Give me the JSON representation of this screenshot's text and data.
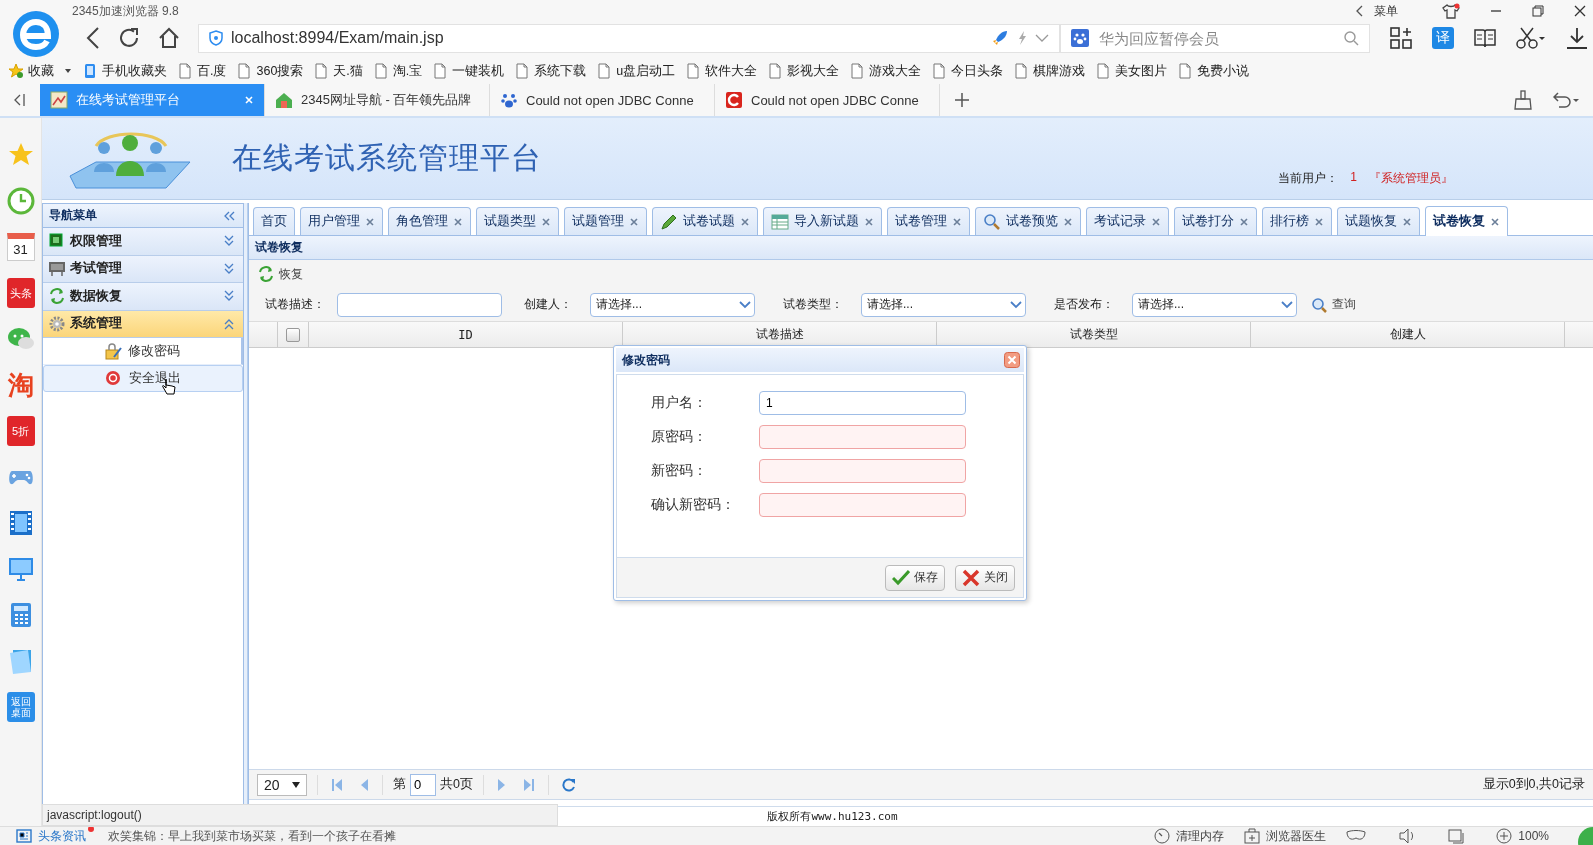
{
  "browser": {
    "title": "2345加速浏览器 9.8",
    "menu_label": "菜单",
    "url": "localhost:8994/Exam/main.jsp",
    "search_placeholder": "华为回应暂停会员",
    "translate_label": "译"
  },
  "bookmarks": [
    {
      "label": "收藏",
      "kind": "star"
    },
    {
      "label": "手机收藏夹",
      "kind": "phone"
    },
    {
      "label": "百.度",
      "kind": "page"
    },
    {
      "label": "360搜索",
      "kind": "page"
    },
    {
      "label": "天.猫",
      "kind": "page"
    },
    {
      "label": "淘.宝",
      "kind": "page"
    },
    {
      "label": "一键装机",
      "kind": "page"
    },
    {
      "label": "系统下载",
      "kind": "page"
    },
    {
      "label": "u盘启动工",
      "kind": "page"
    },
    {
      "label": "软件大全",
      "kind": "page"
    },
    {
      "label": "影视大全",
      "kind": "page"
    },
    {
      "label": "游戏大全",
      "kind": "page"
    },
    {
      "label": "今日头条",
      "kind": "page"
    },
    {
      "label": "棋牌游戏",
      "kind": "page"
    },
    {
      "label": "美女图片",
      "kind": "page"
    },
    {
      "label": "免费小说",
      "kind": "page"
    }
  ],
  "browser_tabs": [
    {
      "title": "在线考试管理平台",
      "selected": true
    },
    {
      "title": "2345网址导航 - 百年领先品牌",
      "selected": false
    },
    {
      "title": "Could not open JDBC Conne",
      "selected": false
    },
    {
      "title": "Could not open JDBC Conne",
      "selected": false
    }
  ],
  "side_apps": [
    {
      "kind": "star"
    },
    {
      "kind": "clock"
    },
    {
      "kind": "calendar",
      "text": "31"
    },
    {
      "kind": "tile",
      "text": "头条"
    },
    {
      "kind": "chat"
    },
    {
      "kind": "bigchar",
      "text": "淘"
    },
    {
      "kind": "tile",
      "text": "5折"
    },
    {
      "kind": "gamepad"
    },
    {
      "kind": "film"
    },
    {
      "kind": "monitor"
    },
    {
      "kind": "calculator"
    },
    {
      "kind": "notebook"
    },
    {
      "kind": "tile",
      "text": "返回桌面"
    }
  ],
  "app": {
    "title": "在线考试系统管理平台",
    "user_label": "当前用户：",
    "user": "1",
    "role": "『系统管理员』"
  },
  "nav": {
    "title": "导航菜单",
    "groups": [
      {
        "label": "权限管理",
        "expanded": false
      },
      {
        "label": "考试管理",
        "expanded": false
      },
      {
        "label": "数据恢复",
        "expanded": false
      },
      {
        "label": "系统管理",
        "expanded": true,
        "children": [
          {
            "label": "修改密码",
            "hovered": false
          },
          {
            "label": "安全退出",
            "hovered": true
          }
        ]
      }
    ]
  },
  "tabs": [
    {
      "label": "首页",
      "closable": false,
      "selected": false
    },
    {
      "label": "用户管理",
      "closable": true,
      "selected": false
    },
    {
      "label": "角色管理",
      "closable": true,
      "selected": false
    },
    {
      "label": "试题类型",
      "closable": true,
      "selected": false
    },
    {
      "label": "试题管理",
      "closable": true,
      "selected": false
    },
    {
      "label": "试卷试题",
      "closable": true,
      "selected": false
    },
    {
      "label": "导入新试题",
      "closable": true,
      "selected": false
    },
    {
      "label": "试卷管理",
      "closable": true,
      "selected": false
    },
    {
      "label": "试卷预览",
      "closable": true,
      "selected": false
    },
    {
      "label": "考试记录",
      "closable": true,
      "selected": false
    },
    {
      "label": "试卷打分",
      "closable": true,
      "selected": false
    },
    {
      "label": "排行榜",
      "closable": true,
      "selected": false
    },
    {
      "label": "试题恢复",
      "closable": true,
      "selected": false
    },
    {
      "label": "试卷恢复",
      "closable": true,
      "selected": true
    }
  ],
  "panel": {
    "title": "试卷恢复",
    "toolbar_button": "恢复",
    "filters": [
      {
        "label": "试卷描述：",
        "kind": "text"
      },
      {
        "label": "创建人：",
        "kind": "select",
        "value": "请选择..."
      },
      {
        "label": "试卷类型：",
        "kind": "select",
        "value": "请选择..."
      },
      {
        "label": "是否发布：",
        "kind": "select",
        "value": "请选择..."
      }
    ],
    "search_button": "查询",
    "header_checked": false,
    "columns": [
      "ID",
      "试卷描述",
      "试卷类型",
      "创建人"
    ]
  },
  "pager": {
    "page_size": "20",
    "page_prefix": "第",
    "page": "0",
    "page_suffix": "共0页",
    "summary": "显示0到0,共0记录"
  },
  "footer": "版权所有www.hu123.com",
  "dialog": {
    "title": "修改密码",
    "fields": [
      {
        "label": "用户名：",
        "value": "1",
        "invalid": false
      },
      {
        "label": "原密码：",
        "invalid": true
      },
      {
        "label": "新密码：",
        "invalid": true
      },
      {
        "label": "确认新密码：",
        "invalid": true
      }
    ],
    "buttons": [
      {
        "label": "保存"
      },
      {
        "label": "关闭"
      }
    ]
  },
  "status_url": "javascript:logout()",
  "news": {
    "label": "头条资讯",
    "headline": "欢笑集锦：早上我到菜市场买菜，看到一个孩子在看摊"
  },
  "tools": {
    "clean": "清理内存",
    "doctor": "浏览器医生",
    "zoom": "100%"
  }
}
